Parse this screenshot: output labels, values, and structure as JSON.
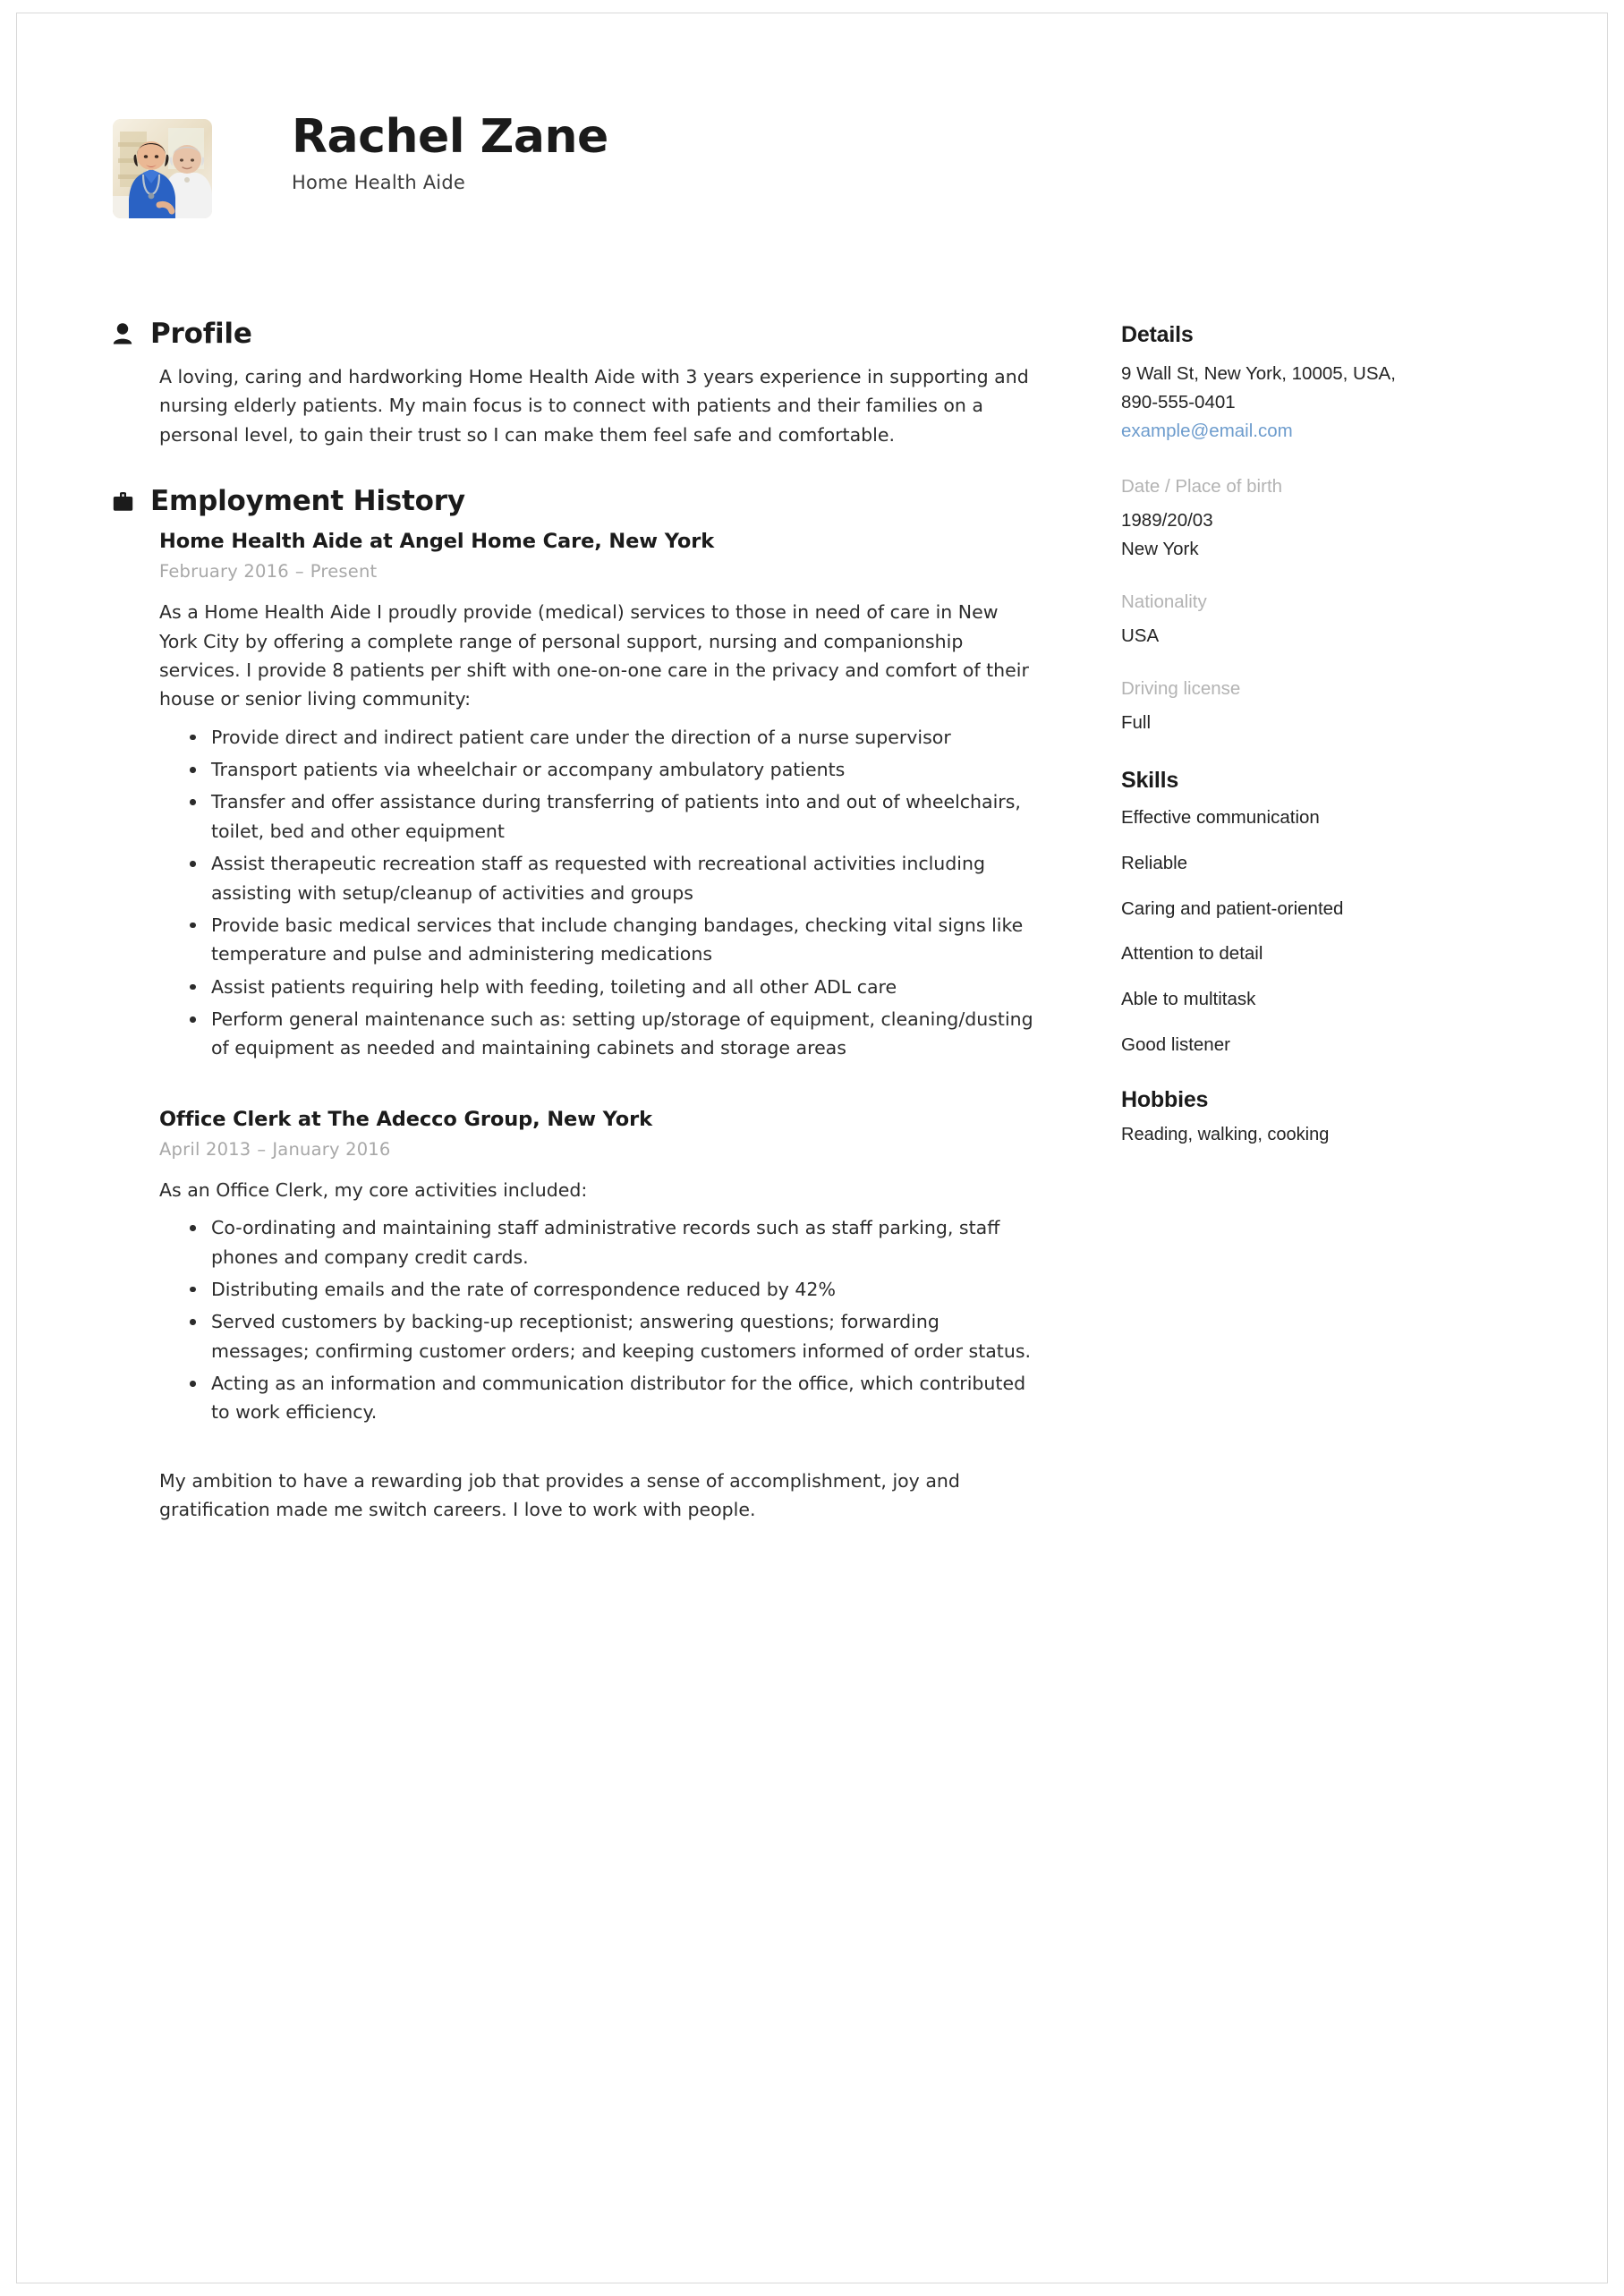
{
  "header": {
    "name": "Rachel Zane",
    "job_title": "Home Health Aide",
    "avatar_alt": "portrait-photo"
  },
  "profile": {
    "icon": "person-icon",
    "title": "Profile",
    "text": "A loving, caring and hardworking Home Health Aide with 3 years experience in supporting and nursing elderly patients. My main focus is to connect with patients and their families on a personal level, to gain their trust so I can make them feel safe and comfortable."
  },
  "employment": {
    "icon": "briefcase-icon",
    "title": "Employment History",
    "jobs": [
      {
        "heading": "Home Health Aide at Angel Home Care, New York",
        "date_start": "February 2016",
        "date_separator": "–",
        "date_end": "Present",
        "description": "As a Home Health Aide I proudly provide (medical) services to those in need of care in New York City by offering a complete range of personal support, nursing and companionship services. I provide 8 patients per shift with one-on-one care in the privacy and comfort of their house or senior living community:",
        "bullets": [
          "Provide direct and indirect patient care under the direction of a nurse supervisor",
          "Transport patients via wheelchair or accompany ambulatory patients",
          "Transfer and offer assistance during transferring of patients into and out of wheelchairs, toilet, bed and other equipment",
          "Assist therapeutic recreation staff as requested with recreational activities including assisting with setup/cleanup of activities and groups",
          "Provide basic medical services that include changing bandages, checking vital signs like temperature and pulse and administering medications",
          "Assist patients requiring help with feeding, toileting and all other ADL care",
          "Perform general maintenance such as: setting up/storage of equipment, cleaning/dusting of equipment as needed and maintaining cabinets and storage areas"
        ]
      },
      {
        "heading": "Office Clerk at The Adecco Group, New York",
        "date_start": "April 2013",
        "date_separator": "–",
        "date_end": "January 2016",
        "description": "As an Office Clerk, my core activities included:",
        "bullets": [
          "Co-ordinating and maintaining staff administrative records such as staff parking, staff phones and company credit cards.",
          "Distributing emails and the rate of correspondence reduced by 42%",
          "Served customers by backing-up receptionist; answering questions; forwarding messages; confirming customer orders; and keeping customers informed of order status.",
          "Acting as an information and communication distributor for the office, which contributed to work efficiency."
        ]
      }
    ],
    "closing": "My ambition to have a rewarding job that provides a sense of accomplishment, joy and gratification made me switch careers. I love to work with people."
  },
  "sidebar": {
    "details": {
      "title": "Details",
      "address": "9 Wall St, New York, 10005, USA,",
      "phone": "890-555-0401",
      "email": "example@email.com",
      "birth_label": "Date / Place of birth",
      "birth_date": "1989/20/03",
      "birth_place": "New York",
      "nationality_label": "Nationality",
      "nationality_value": "USA",
      "license_label": "Driving license",
      "license_value": "Full"
    },
    "skills": {
      "title": "Skills",
      "items": [
        "Effective communication",
        "Reliable",
        "Caring and patient-oriented",
        "Attention to detail",
        "Able to multitask",
        "Good listener"
      ]
    },
    "hobbies": {
      "title": "Hobbies",
      "text": "Reading, walking, cooking"
    }
  },
  "colors": {
    "text": "#2c2c2c",
    "heading": "#1b1b1b",
    "muted": "#a8a8a8",
    "label": "#b3b3b3",
    "link": "#6d9ccd",
    "border": "#d8d8d8"
  }
}
